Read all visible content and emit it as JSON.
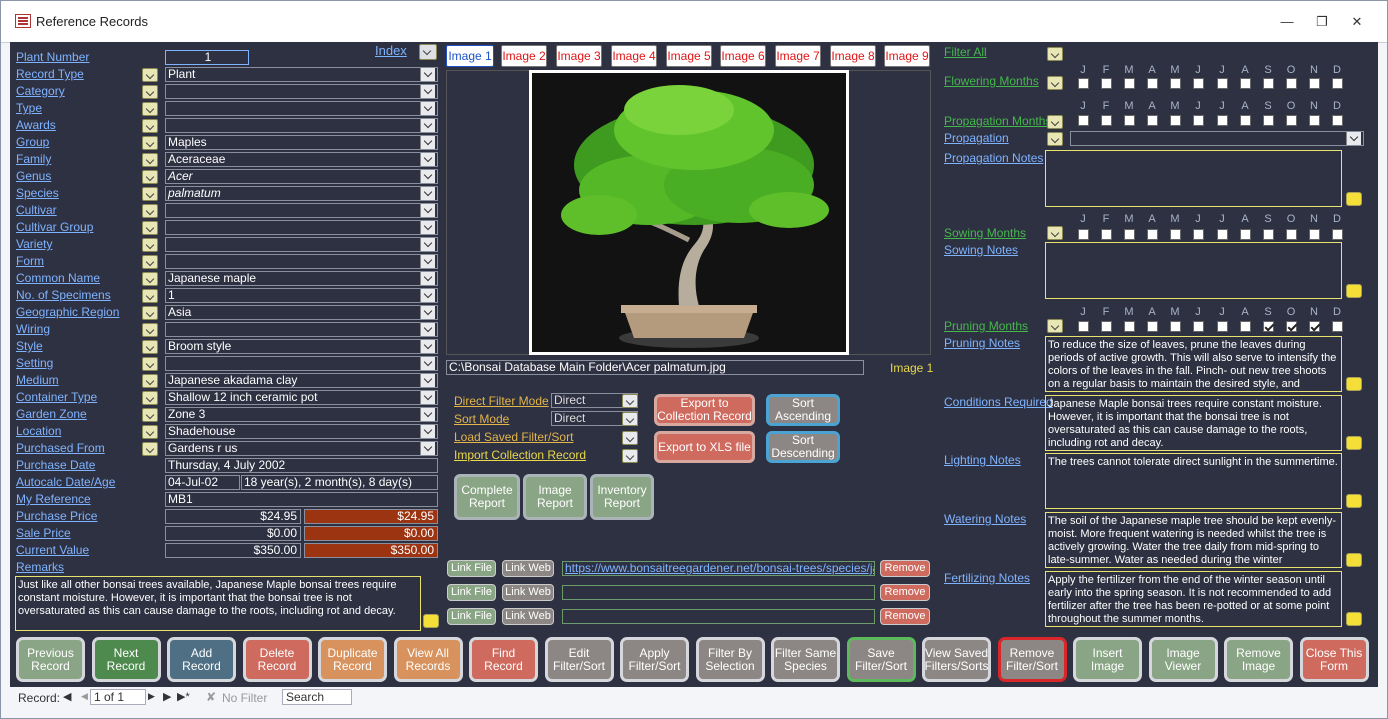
{
  "window": {
    "title": "Reference Records"
  },
  "index_label": "Index",
  "left_fields": [
    {
      "label": "Plant Number",
      "value": "1"
    },
    {
      "label": "Record Type",
      "value": "Plant"
    },
    {
      "label": "Category",
      "value": ""
    },
    {
      "label": "Type",
      "value": ""
    },
    {
      "label": "Awards",
      "value": ""
    },
    {
      "label": "Group",
      "value": "Maples"
    },
    {
      "label": "Family",
      "value": "Aceraceae"
    },
    {
      "label": "Genus",
      "value": "Acer"
    },
    {
      "label": "Species",
      "value": "palmatum"
    },
    {
      "label": "Cultivar",
      "value": ""
    },
    {
      "label": "Cultivar Group",
      "value": ""
    },
    {
      "label": "Variety",
      "value": ""
    },
    {
      "label": "Form",
      "value": ""
    },
    {
      "label": "Common Name",
      "value": "Japanese maple"
    },
    {
      "label": "No. of Specimens",
      "value": "1"
    },
    {
      "label": "Geographic Region",
      "value": "Asia"
    },
    {
      "label": "Wiring",
      "value": ""
    },
    {
      "label": "Style",
      "value": "Broom style"
    },
    {
      "label": "Setting",
      "value": ""
    },
    {
      "label": "Medium",
      "value": "Japanese akadama clay"
    },
    {
      "label": "Container Type",
      "value": "Shallow 12 inch ceramic pot"
    },
    {
      "label": "Garden Zone",
      "value": "Zone 3"
    },
    {
      "label": "Location",
      "value": "Shadehouse"
    },
    {
      "label": "Purchased From",
      "value": "Gardens r us"
    }
  ],
  "purchase_date": {
    "label": "Purchase Date",
    "value": "Thursday, 4 July 2002"
  },
  "autocalc": {
    "label": "Autocalc Date/Age",
    "date": "04-Jul-02",
    "age": "18 year(s), 2 month(s), 8 day(s)"
  },
  "my_reference": {
    "label": "My Reference",
    "value": "MB1"
  },
  "purchase_price": {
    "label": "Purchase Price",
    "value": "$24.95",
    "value2": "$24.95"
  },
  "sale_price": {
    "label": "Sale Price",
    "value": "$0.00",
    "value2": "$0.00"
  },
  "current_value": {
    "label": "Current Value",
    "value": "$350.00",
    "value2": "$350.00"
  },
  "remarks": {
    "label": "Remarks",
    "text": "Just like all other bonsai trees available, Japanese Maple bonsai trees require constant moisture. However, it is important that the bonsai tree is not oversaturated as this can cause damage to the roots, including rot and decay."
  },
  "image_tabs": [
    "Image 1",
    "Image 2",
    "Image 3",
    "Image 4",
    "Image 5",
    "Image 6",
    "Image 7",
    "Image 8",
    "Image 9"
  ],
  "image_path": "C:\\Bonsai Database Main Folder\\Acer palmatum.jpg",
  "image_caption": "Image 1",
  "filter": {
    "direct_filter_mode_label": "Direct Filter Mode",
    "direct_filter_mode_value": "Direct",
    "sort_mode_label": "Sort Mode",
    "sort_mode_value": "Direct",
    "load_saved_label": "Load Saved Filter/Sort",
    "import_label": "Import Collection Record"
  },
  "mid_buttons": {
    "export_collection": "Export to Collection Record",
    "export_xls": "Export to XLS file",
    "sort_asc": "Sort Ascending",
    "sort_desc": "Sort Descending",
    "complete_report": "Complete Report",
    "image_report": "Image Report",
    "inventory_report": "Inventory Report"
  },
  "links": {
    "link_file": "Link File",
    "link_web": "Link Web",
    "remove": "Remove",
    "url1": "https://www.bonsaitreegardener.net/bonsai-trees/species/japanese-maple"
  },
  "right": {
    "filter_all": "Filter All",
    "months": [
      "J",
      "F",
      "M",
      "A",
      "M",
      "J",
      "J",
      "A",
      "S",
      "O",
      "N",
      "D"
    ],
    "flowering": "Flowering Months",
    "propagation_months": "Propagation Months",
    "propagation": "Propagation",
    "propagation_notes": "Propagation Notes",
    "sowing_months": "Sowing Months",
    "sowing_notes": "Sowing Notes",
    "pruning_months": "Pruning Months",
    "pruning_checked": [
      false,
      false,
      false,
      false,
      false,
      false,
      false,
      false,
      true,
      true,
      true,
      false
    ],
    "pruning_notes": "Pruning Notes",
    "pruning_text": "To reduce the size of leaves, prune the leaves during periods of active growth. This will also serve to intensify the colors of the leaves in the fall. Pinch- out new tree shoots on a regular basis to maintain the desired style, and",
    "conditions": "Conditions Required",
    "conditions_text": "Japanese Maple bonsai trees require constant moisture. However, it is important that the bonsai tree is not oversaturated as this can cause damage to the roots, including rot and decay.",
    "lighting": "Lighting Notes",
    "lighting_text": "The trees cannot tolerate direct sunlight in the summertime.",
    "watering": "Watering Notes",
    "watering_text": "The soil of the Japanese maple tree should be kept evenly-moist. More frequent watering is needed whilst the tree is actively growing. Water the tree daily from mid-spring to late-summer. Water as needed during the winter",
    "fertilizing": "Fertilizing Notes",
    "fertilizing_text": "Apply the fertilizer from the end of the winter season until early into the spring season. It is not recommended to add fertilizer after the tree has been re-potted or at some point throughout the summer months."
  },
  "bottom_buttons": [
    {
      "label": "Previous Record",
      "color": "#8aa585"
    },
    {
      "label": "Next Record",
      "color": "#4e8a4e"
    },
    {
      "label": "Add Record",
      "color": "#4e6f84"
    },
    {
      "label": "Delete Record",
      "color": "#cf6a5e"
    },
    {
      "label": "Duplicate Record",
      "color": "#d7925d"
    },
    {
      "label": "View All Records",
      "color": "#d7925d"
    },
    {
      "label": "Find Record",
      "color": "#cf6a5e"
    },
    {
      "label": "Edit Filter/Sort",
      "color": "#8c8784"
    },
    {
      "label": "Apply Filter/Sort",
      "color": "#8c8784"
    },
    {
      "label": "Filter By Selection",
      "color": "#8c8784"
    },
    {
      "label": "Filter Same Species",
      "color": "#8c8784"
    },
    {
      "label": "Save Filter/Sort",
      "color": "#8c8784"
    },
    {
      "label": "View Saved Filters/Sorts",
      "color": "#8c8784"
    },
    {
      "label": "Remove Filter/Sort",
      "color": "#8c8784"
    },
    {
      "label": "Insert Image",
      "color": "#8aa585"
    },
    {
      "label": "Image Viewer",
      "color": "#8aa585"
    },
    {
      "label": "Remove Image",
      "color": "#8aa585"
    },
    {
      "label": "Close This Form",
      "color": "#cf6a5e"
    }
  ],
  "status": {
    "record_label": "Record:",
    "record_value": "1 of 1",
    "filter": "No Filter",
    "search": "Search"
  }
}
